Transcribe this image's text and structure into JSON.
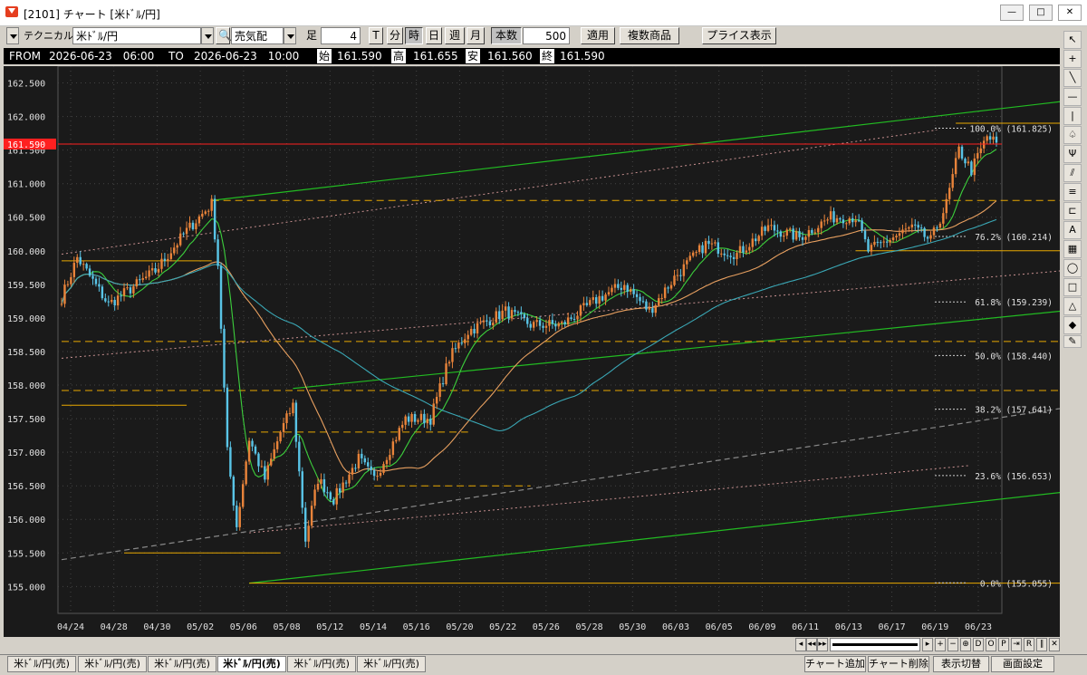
{
  "window": {
    "title": "[2101] チャート [米ﾄﾞﾙ/円]",
    "minimize": "—",
    "maximize": "□",
    "close": "✕"
  },
  "toolbar": {
    "technical": "テクニカル",
    "symbol": "米ﾄﾞﾙ/円",
    "sentiment": "売気配",
    "ashi_label": "足",
    "ashi_value": "4",
    "frames": [
      "T",
      "分",
      "時",
      "日",
      "週",
      "月"
    ],
    "active_frame": "時",
    "count_label": "本数",
    "count_value": "500",
    "apply": "適用",
    "multi": "複数商品",
    "price_display": "プライス表示"
  },
  "infobar": {
    "from_label": "FROM",
    "from_value": "2026-06-23　06:00",
    "to_label": "TO",
    "to_value": "2026-06-23　10:00",
    "open_label": "始",
    "open_value": "161.590",
    "high_label": "高",
    "high_value": "161.655",
    "low_label": "安",
    "low_value": "161.560",
    "close_label": "終",
    "close_value": "161.590"
  },
  "colors": {
    "bg": "#1a1a1a",
    "up": "#e8833a",
    "down": "#59c4e6",
    "ma_short": "#3ccf3c",
    "ma_long": "#e8a060",
    "ma_mid": "#3aa7b5",
    "trend": "#22bb22",
    "fibo": "#e8a800",
    "current": "#ff2020"
  },
  "chart_data": {
    "type": "candlestick",
    "y_ticks": [
      "162.500",
      "162.000",
      "161.500",
      "161.000",
      "160.500",
      "160.000",
      "159.500",
      "159.000",
      "158.500",
      "158.000",
      "157.500",
      "157.000",
      "156.500",
      "156.000",
      "155.500",
      "155.000"
    ],
    "ylim": [
      154.6,
      162.75
    ],
    "x_ticks": [
      "04/24",
      "04/28",
      "04/30",
      "05/02",
      "05/06",
      "05/08",
      "05/12",
      "05/14",
      "05/16",
      "05/20",
      "05/22",
      "05/26",
      "05/28",
      "05/30",
      "06/03",
      "06/05",
      "06/09",
      "06/11",
      "06/13",
      "06/17",
      "06/19",
      "06/23"
    ],
    "current_price": "161.590",
    "fibonacci": [
      {
        "label": "100.0% (161.825)",
        "value": 161.825
      },
      {
        "label": "76.2% (160.214)",
        "value": 160.214
      },
      {
        "label": "61.8% (159.239)",
        "value": 159.239
      },
      {
        "label": "50.0% (158.440)",
        "value": 158.44
      },
      {
        "label": "38.2% (157.641)",
        "value": 157.641
      },
      {
        "label": "23.6% (156.653)",
        "value": 156.653
      },
      {
        "label": "0.0% (155.055)",
        "value": 155.055
      }
    ],
    "path": [
      [
        0,
        159.3
      ],
      [
        5,
        159.9
      ],
      [
        15,
        159.2
      ],
      [
        30,
        159.7
      ],
      [
        40,
        160.3
      ],
      [
        48,
        160.7
      ],
      [
        50,
        159.8
      ],
      [
        53,
        157.0
      ],
      [
        56,
        155.9
      ],
      [
        60,
        157.2
      ],
      [
        65,
        156.6
      ],
      [
        70,
        157.3
      ],
      [
        74,
        157.7
      ],
      [
        78,
        155.7
      ],
      [
        82,
        156.6
      ],
      [
        87,
        156.3
      ],
      [
        95,
        156.9
      ],
      [
        100,
        156.6
      ],
      [
        110,
        157.5
      ],
      [
        118,
        157.5
      ],
      [
        124,
        158.4
      ],
      [
        130,
        158.8
      ],
      [
        142,
        159.1
      ],
      [
        150,
        158.9
      ],
      [
        160,
        158.9
      ],
      [
        172,
        159.3
      ],
      [
        180,
        159.5
      ],
      [
        188,
        159.1
      ],
      [
        196,
        159.6
      ],
      [
        206,
        160.1
      ],
      [
        216,
        159.95
      ],
      [
        226,
        160.35
      ],
      [
        236,
        160.2
      ],
      [
        246,
        160.5
      ],
      [
        254,
        160.5
      ],
      [
        258,
        160.0
      ],
      [
        264,
        160.15
      ],
      [
        272,
        160.35
      ],
      [
        278,
        160.15
      ],
      [
        283,
        160.7
      ],
      [
        287,
        161.5
      ],
      [
        291,
        161.2
      ],
      [
        296,
        161.7
      ],
      [
        299,
        161.6
      ]
    ]
  },
  "scrollbar": {
    "buttons": [
      "◂",
      "◂◂",
      "▸▸",
      "▸"
    ],
    "zoom_in": "+",
    "zoom_out": "−",
    "letters": [
      "D",
      "O",
      "P",
      "R"
    ]
  },
  "tabs": [
    "米ﾄﾞﾙ/円(売)",
    "米ﾄﾞﾙ/円(売)",
    "米ﾄﾞﾙ/円(売)",
    "米ﾄﾞﾙ/円(売)",
    "米ﾄﾞﾙ/円(売)",
    "米ﾄﾞﾙ/円(売)"
  ],
  "active_tab": 3,
  "bottom_buttons": {
    "add": "チャート追加",
    "remove": "チャート削除",
    "switch": "表示切替",
    "settings": "画面設定"
  }
}
